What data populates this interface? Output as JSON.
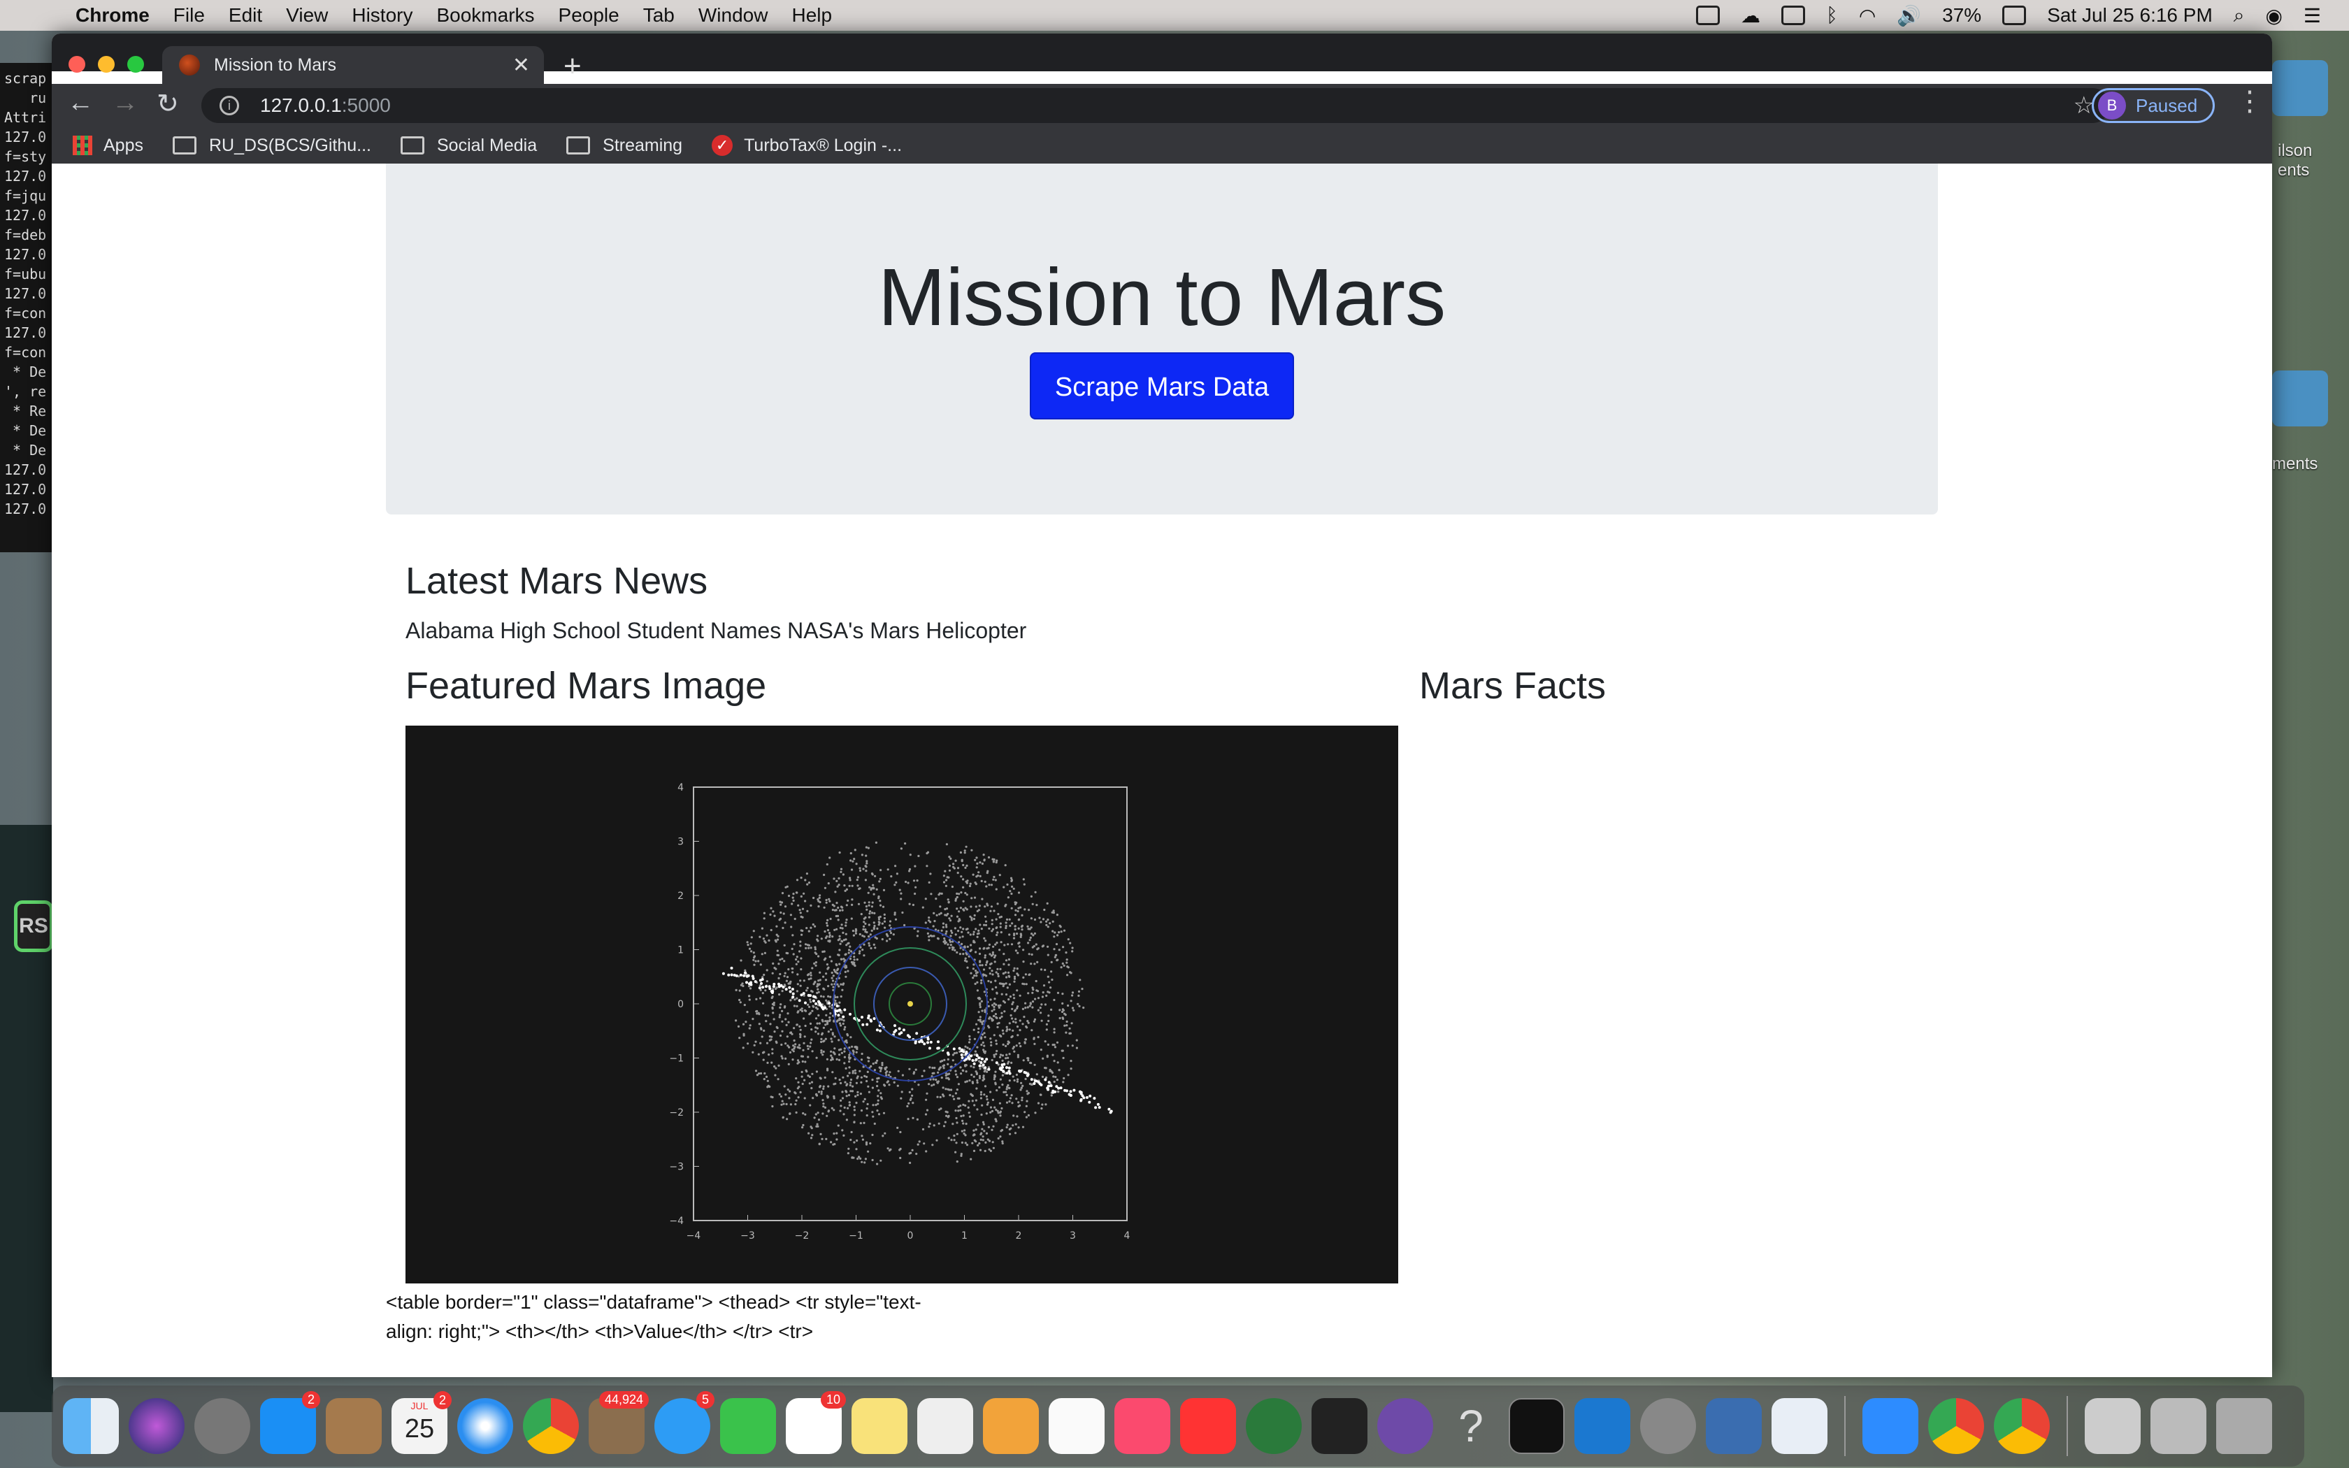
{
  "menubar": {
    "items": [
      "Chrome",
      "File",
      "Edit",
      "View",
      "History",
      "Bookmarks",
      "People",
      "Tab",
      "Window",
      "Help"
    ],
    "battery": "37%",
    "datetime": "Sat Jul 25  6:16 PM"
  },
  "terminal": {
    "lines": [
      "scrap",
      "   ru",
      "Attri",
      "127.0",
      "f=sty",
      "127.0",
      "f=jqu",
      "127.0",
      "f=deb",
      "127.0",
      "f=ubu",
      "127.0",
      "f=con",
      "127.0",
      "f=con",
      " * De",
      "', re",
      " * Re",
      " * De",
      " * De",
      "127.0",
      "127.0",
      "127.0"
    ]
  },
  "side_panel": {
    "badge_text": "RS"
  },
  "desktop": {
    "label_1": "ilson\nents",
    "label_2": "ments"
  },
  "browser": {
    "tab_title": "Mission to Mars",
    "url_host": "127.0.0.1",
    "url_port": ":5000",
    "profile_initial": "B",
    "profile_status": "Paused",
    "bookmarks": [
      "Apps",
      "RU_DS(BCS/Githu...",
      "Social Media",
      "Streaming",
      "TurboTax® Login -..."
    ]
  },
  "page": {
    "title": "Mission to Mars",
    "scrape_button": "Scrape Mars Data",
    "news_heading": "Latest Mars News",
    "news_title": "Alabama High School Student Names NASA's Mars Helicopter",
    "image_heading": "Featured Mars Image",
    "facts_heading": "Mars Facts",
    "facts_raw_line1": "<table border=\"1\" class=\"dataframe\"> <thead> <tr style=\"text-",
    "facts_raw_line2": "align: right;\"> <th></th> <th>Value</th> </tr> <tr>"
  },
  "featured_image": {
    "x_ticks": [
      "−4",
      "−3",
      "−2",
      "−1",
      "0",
      "1",
      "2",
      "3",
      "4"
    ],
    "y_ticks": [
      "4",
      "3",
      "2",
      "1",
      "0",
      "−1",
      "−2",
      "−3",
      "−4"
    ]
  },
  "dock": {
    "badges": {
      "app_store": "2",
      "calendar": "2",
      "mail": "44,924",
      "messages": "5",
      "slack": "10"
    },
    "calendar_month": "JUL",
    "calendar_day": "25"
  }
}
